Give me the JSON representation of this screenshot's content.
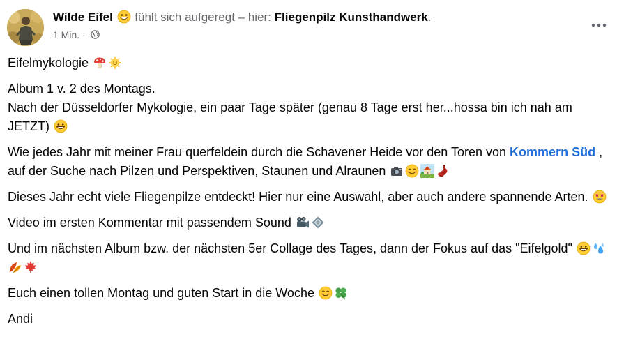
{
  "header": {
    "author_name": "Wilde Eifel",
    "feeling": "fühlt sich aufgeregt",
    "location_prefix": "– hier:",
    "location_name": "Fliegenpilz Kunsthandwerk",
    "trailing_dot": ".",
    "timestamp": "1 Min.",
    "separator": "·",
    "privacy_icon": "globe-icon",
    "more_icon": "ellipsis-icon"
  },
  "post": {
    "p1": {
      "text": "Eifelmykologie"
    },
    "p2": {
      "line1": "Album 1 v. 2 des Montags.",
      "line2": "Nach der Düsseldorfer Mykologie, ein paar Tage später (genau 8 Tage erst her...hossa bin ich nah am JETZT)"
    },
    "p3": {
      "before": "Wie jedes Jahr mit meiner Frau querfeldein durch die Schavener Heide vor den Toren von ",
      "mention": "Kommern Süd",
      "after": " , auf der Suche nach Pilzen und Perspektiven, Staunen und Alraunen"
    },
    "p4": {
      "text": "Dieses Jahr echt viele Fliegenpilze entdeckt! Hier nur eine Auswahl, aber auch andere spannende Arten."
    },
    "p5": {
      "text": "Video im ersten Kommentar mit passendem Sound"
    },
    "p6": {
      "text": "Und im nächsten Album bzw. der nächsten 5er Collage des Tages, dann der Fokus auf das \"Eifelgold\""
    },
    "p7": {
      "text": "Euch einen tollen Montag und guten Start in die Woche"
    },
    "p8": {
      "text": "Andi"
    }
  },
  "emojis": {
    "p1": [
      "mushroom-emoji",
      "sun-with-face-emoji"
    ],
    "p2": [
      "grinning-emoji"
    ],
    "p3": [
      "camera-emoji",
      "smiling-emoji",
      "house-garden-emoji",
      "wine-bottle-emoji"
    ],
    "p4": [
      "star-struck-emoji"
    ],
    "p5": [
      "movie-camera-emoji",
      "diamond-emoji"
    ],
    "p6": [
      "grinning-emoji",
      "sweat-droplet-emoji",
      "leaves-emoji",
      "maple-leaf-emoji"
    ],
    "p7": [
      "smiling-emoji",
      "four-leaf-clover-emoji"
    ]
  },
  "colors": {
    "text": "#050505",
    "secondary_text": "#65676b",
    "link": "#216fdb"
  }
}
